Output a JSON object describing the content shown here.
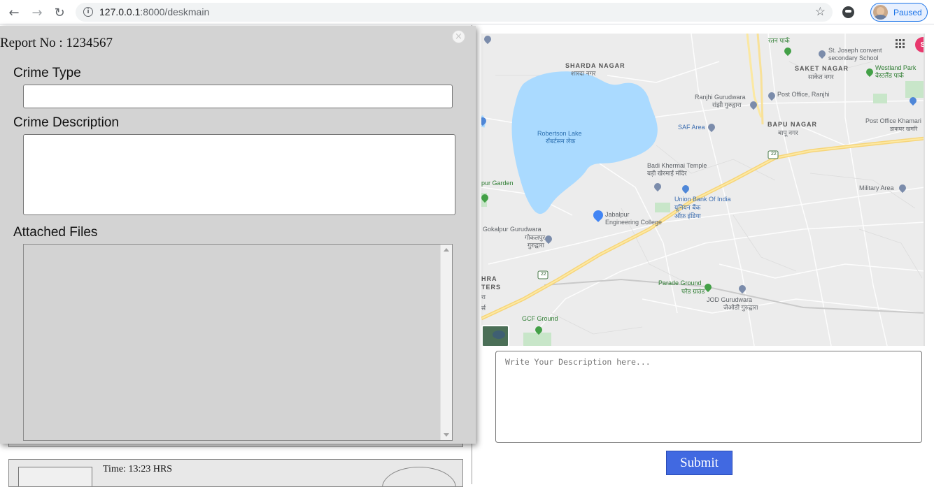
{
  "browser": {
    "url_host": "127.0.0.1",
    "url_path": ":8000/deskmain",
    "profile_status": "Paused",
    "icons": [
      "back-arrow",
      "forward-arrow",
      "reload",
      "site-info",
      "bookmark-star",
      "extension",
      "profile-avatar"
    ]
  },
  "modal": {
    "report_no": "Report No : 1234567",
    "crime_type_label": "Crime Type",
    "crime_type_value": "",
    "crime_description_label": "Crime Description",
    "crime_description_value": "",
    "attached_files_label": "Attached Files"
  },
  "report_list": [
    {
      "time": ""
    },
    {
      "time": "Time: 13:23 HRS"
    }
  ],
  "map": {
    "labels": {
      "sharda_nagar": "SHARDA NAGAR",
      "sharda_nagar_hi": "शारदा नगर",
      "robertson_lake": "Robertson Lake",
      "robertson_lake_hi": "रॉबर्टसन लेक",
      "ranjhi_gurudwara": "Ranjhi Gurudwara",
      "ranjhi_gurudwara_hi": "रांझी गुरुद्वारा",
      "post_office_ranjhi": "Post Office, Ranjhi",
      "saket_nagar": "SAKET NAGAR",
      "saket_nagar_hi": "साकेत नगर",
      "st_joseph": "St. Joseph convent",
      "st_joseph_2": "secondary School",
      "westland_park": "Westland Park",
      "westland_park_hi": "वेस्टलैंड पार्क",
      "saf_area": "SAF Area",
      "bapu_nagar": "BAPU NAGAR",
      "bapu_nagar_hi": "बापू नगर",
      "post_office_khamaria": "Post Office Khamari",
      "post_office_khamaria_hi": "डाकघर खमरि",
      "badi_khermai": "Badi Khermai Temple",
      "badi_khermai_hi": "बड़ी खेरमाई मंदिर",
      "union_bank": "Union Bank Of India",
      "union_bank_hi": "यूनियन बैंक",
      "union_bank_hi2": "ऑफ़ इंडिया",
      "military_area": "Military Area",
      "jabalpur_college": "Jabalpur",
      "jabalpur_college_2": "Engineering College",
      "gokalpur": "Gokalpur Gurudwara",
      "gokalpur_hi": "गोकलपुर",
      "gokalpur_hi2": "गुरुद्वारा",
      "pur_garden": "pur Garden",
      "parade_ground": "Parade Ground",
      "parade_ground_hi": "परेड ग्राउंड",
      "jod_gurudwara": "JOD Gurudwara",
      "jod_gurudwara_hi": "जेओडी गुरुद्वारा",
      "gcf_ground": "GCF Ground",
      "hra": "HRA",
      "ters": "TERS",
      "ra": "रा",
      "rs": "र्स",
      "highway_22": "22",
      "top_park": "रतन पार्क",
      "account_initial": "S"
    }
  },
  "description": {
    "placeholder": "Write Your Description here..."
  },
  "submit_label": "Submit"
}
